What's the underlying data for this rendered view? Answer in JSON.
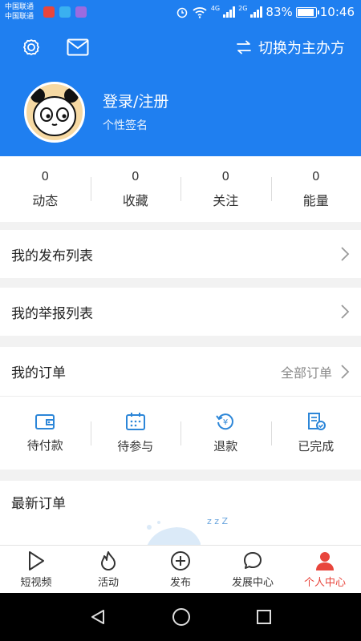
{
  "status_bar": {
    "carrier_1": "中国联通",
    "carrier_2": "中国联通",
    "net_1": "4G",
    "net_2": "2G",
    "battery": "83%",
    "battery_level": 0.83,
    "time": "10:46"
  },
  "header": {
    "switch_label": "切换为主办方",
    "login_label": "登录/注册",
    "signature": "个性签名"
  },
  "stats": [
    {
      "value": "0",
      "label": "动态"
    },
    {
      "value": "0",
      "label": "收藏"
    },
    {
      "value": "0",
      "label": "关注"
    },
    {
      "value": "0",
      "label": "能量"
    }
  ],
  "menu": {
    "my_posts": "我的发布列表",
    "my_reports": "我的举报列表",
    "my_orders": "我的订单",
    "all_orders": "全部订单"
  },
  "order_status": [
    {
      "label": "待付款",
      "icon": "wallet-icon"
    },
    {
      "label": "待参与",
      "icon": "calendar-icon"
    },
    {
      "label": "退款",
      "icon": "refund-icon"
    },
    {
      "label": "已完成",
      "icon": "completed-icon"
    }
  ],
  "latest_orders": {
    "title": "最新订单",
    "sleep_text": "z z Z"
  },
  "tabbar": [
    {
      "label": "短视频",
      "icon": "play-icon"
    },
    {
      "label": "活动",
      "icon": "flame-icon"
    },
    {
      "label": "发布",
      "icon": "plus-circle-icon"
    },
    {
      "label": "发展中心",
      "icon": "chat-icon"
    },
    {
      "label": "个人中心",
      "icon": "person-icon"
    }
  ],
  "colors": {
    "brand": "#1f7ff0",
    "active_tab": "#e8453c",
    "order_icon": "#2c86d8"
  }
}
